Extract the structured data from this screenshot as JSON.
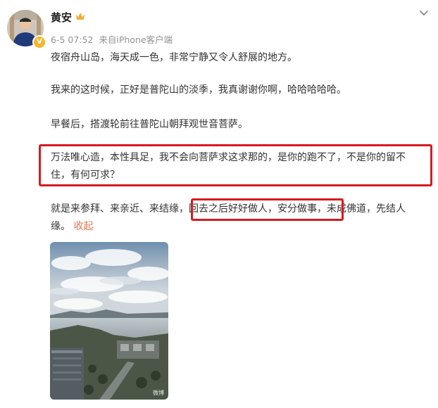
{
  "user": {
    "name": "黄安",
    "verified_badge": "V",
    "time": "6-5 07:52",
    "source_prefix": "来自",
    "source": "iPhone客户端"
  },
  "post": {
    "p1": "夜宿舟山岛，海天成一色，非常宁静又令人舒展的地方。",
    "p2": "我来的这时候，正好是普陀山的淡季，我真谢谢你啊，哈哈哈哈哈。",
    "p3": "早餐后，搭渡轮前往普陀山朝拜观世音菩萨。",
    "p4_line1": "万法唯心造，本性具足，我不会向菩萨求这求那的，是你的跑不了，不是你的留不",
    "p4_line2": "住，有何可求？",
    "p5_part1": "就是来参拜、来亲近、来结缘，",
    "p5_part2": "回去之后好好做人，安分做事，",
    "p5_part3": "未成佛道，先结人",
    "p5_line2": "缘。",
    "collapse": "收起"
  },
  "photo": {
    "watermark": "微博"
  },
  "colors": {
    "highlight_border": "#d71a1f",
    "link": "#eb7350",
    "badge": "#f6b62c"
  },
  "icons": {
    "crown": "crown-icon",
    "more": "chevron-down-icon",
    "verified": "verified-badge-icon"
  }
}
